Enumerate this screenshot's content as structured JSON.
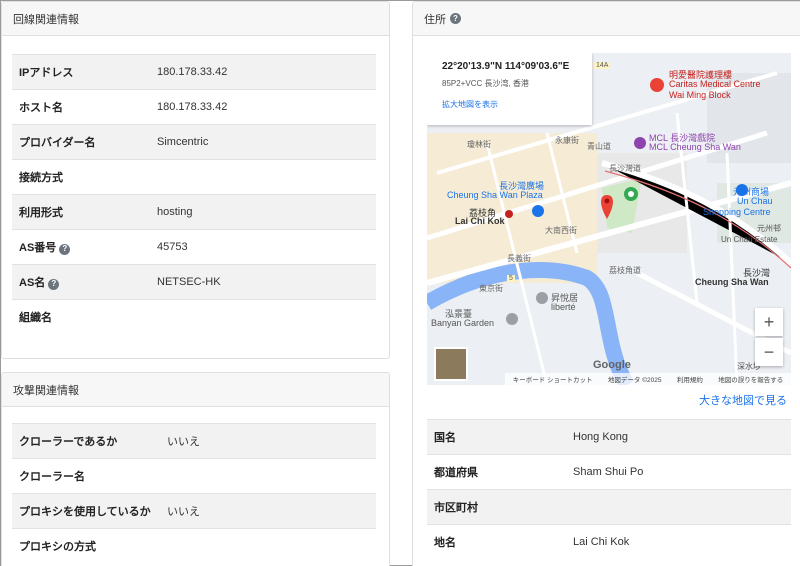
{
  "line_info": {
    "title": "回線関連情報",
    "rows": [
      {
        "key": "IPアドレス",
        "value": "180.178.33.42",
        "help": false
      },
      {
        "key": "ホスト名",
        "value": "180.178.33.42",
        "help": false
      },
      {
        "key": "プロバイダー名",
        "value": "Simcentric",
        "help": false
      },
      {
        "key": "接続方式",
        "value": "",
        "help": false
      },
      {
        "key": "利用形式",
        "value": "hosting",
        "help": false
      },
      {
        "key": "AS番号",
        "value": "45753",
        "help": true
      },
      {
        "key": "AS名",
        "value": "NETSEC-HK",
        "help": true
      },
      {
        "key": "組織名",
        "value": "",
        "help": false
      }
    ]
  },
  "attack_info": {
    "title": "攻撃関連情報",
    "rows": [
      {
        "key": "クローラーであるか",
        "value": "いいえ"
      },
      {
        "key": "クローラー名",
        "value": ""
      },
      {
        "key": "プロキシを使用しているか",
        "value": "いいえ"
      },
      {
        "key": "プロキシの方式",
        "value": ""
      }
    ]
  },
  "address": {
    "title": "住所",
    "big_map_link": "大きな地図で見る",
    "rows": [
      {
        "key": "国名",
        "value": "Hong Kong"
      },
      {
        "key": "都道府県",
        "value": "Sham Shui Po"
      },
      {
        "key": "市区町村",
        "value": ""
      },
      {
        "key": "地名",
        "value": "Lai Chi Kok"
      }
    ]
  },
  "map": {
    "coord": "22°20'13.9\"N 114°09'03.6\"E",
    "plus_code": "85P2+VCC 長沙湾, 香港",
    "enlarge_link": "拡大地図を表示",
    "zoom_in": "+",
    "zoom_out": "−",
    "google": "Google",
    "footer": [
      "キーボード ショートカット",
      "地図データ ©2025",
      "利用規約",
      "地図の誤りを報告する"
    ],
    "labels": [
      {
        "text": "明愛醫院護理樓",
        "color": "#c5221f"
      },
      {
        "text": "Caritas Medical Centre",
        "color": "#c5221f"
      },
      {
        "text": "Wai Ming Block",
        "color": "#c5221f"
      },
      {
        "text": "MCL 長沙灣戲院",
        "color": "#8e44ad"
      },
      {
        "text": "MCL Cheung Sha Wan",
        "color": "#8e44ad"
      },
      {
        "text": "長沙灣廣場",
        "color": "#1a73e8"
      },
      {
        "text": "Cheung Sha Wan Plaza",
        "color": "#1a73e8"
      },
      {
        "text": "荔枝角",
        "color": "#333333"
      },
      {
        "text": "Lai Chi Kok",
        "color": "#333333"
      },
      {
        "text": "元州商場",
        "color": "#1a73e8"
      },
      {
        "text": "Un Chau",
        "color": "#1a73e8"
      },
      {
        "text": "Shopping Centre",
        "color": "#1a73e8"
      },
      {
        "text": "元州邨",
        "color": "#555555"
      },
      {
        "text": "Un Chau Estate",
        "color": "#555555"
      },
      {
        "text": "長沙灣",
        "color": "#333333"
      },
      {
        "text": "Cheung Sha Wan",
        "color": "#333333"
      },
      {
        "text": "昇悅居",
        "color": "#555555"
      },
      {
        "text": "liberté",
        "color": "#555555"
      },
      {
        "text": "泓景臺",
        "color": "#555555"
      },
      {
        "text": "Banyan Garden",
        "color": "#555555"
      },
      {
        "text": "深水埗",
        "color": "#555555"
      },
      {
        "text": "瓊林街",
        "color": "#666666"
      },
      {
        "text": "永康街",
        "color": "#666666"
      },
      {
        "text": "青山道",
        "color": "#666666"
      },
      {
        "text": "長沙灣道",
        "color": "#666666"
      },
      {
        "text": "大南西街",
        "color": "#666666"
      },
      {
        "text": "長義街",
        "color": "#666666"
      },
      {
        "text": "荔枝角道",
        "color": "#666666"
      },
      {
        "text": "東京街",
        "color": "#666666"
      },
      {
        "text": "14A",
        "color": "#555555"
      },
      {
        "text": "5",
        "color": "#555555"
      }
    ]
  }
}
